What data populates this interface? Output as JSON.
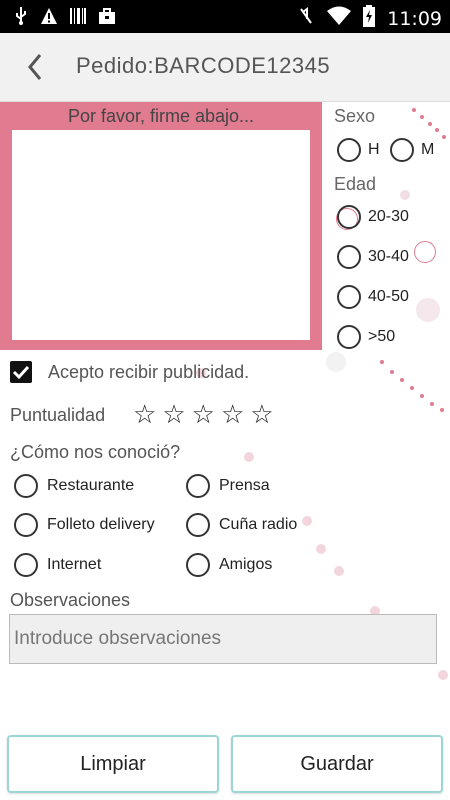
{
  "status_bar": {
    "icons": [
      "usb-icon",
      "warning-icon",
      "barcode-icon",
      "briefcase-icon",
      "mute-icon",
      "wifi-icon",
      "battery-icon"
    ],
    "time": "11:09"
  },
  "app_bar": {
    "title": "Pedido:BARCODE12345",
    "back_icon": "chevron-left-icon"
  },
  "signature": {
    "prompt": "Por favor, firme abajo..."
  },
  "sexo": {
    "label": "Sexo",
    "options": [
      "H",
      "M"
    ]
  },
  "edad": {
    "label": "Edad",
    "options": [
      "20-30",
      "30-40",
      "40-50",
      ">50"
    ]
  },
  "publicidad": {
    "label": "Acepto recibir publicidad.",
    "checked": true
  },
  "puntualidad": {
    "label": "Puntualidad",
    "stars_total": 5,
    "stars_filled": 0
  },
  "conocio": {
    "label": "¿Cómo nos conoció?",
    "options": [
      "Restaurante",
      "Prensa",
      "Folleto delivery",
      "Cuña radio",
      "Internet",
      "Amigos"
    ]
  },
  "observaciones": {
    "label": "Observaciones",
    "placeholder": "Introduce observaciones",
    "value": ""
  },
  "buttons": {
    "clear": "Limpiar",
    "save": "Guardar"
  },
  "colors": {
    "accent_pink": "#e07b90",
    "button_border": "#9ad6d6"
  }
}
